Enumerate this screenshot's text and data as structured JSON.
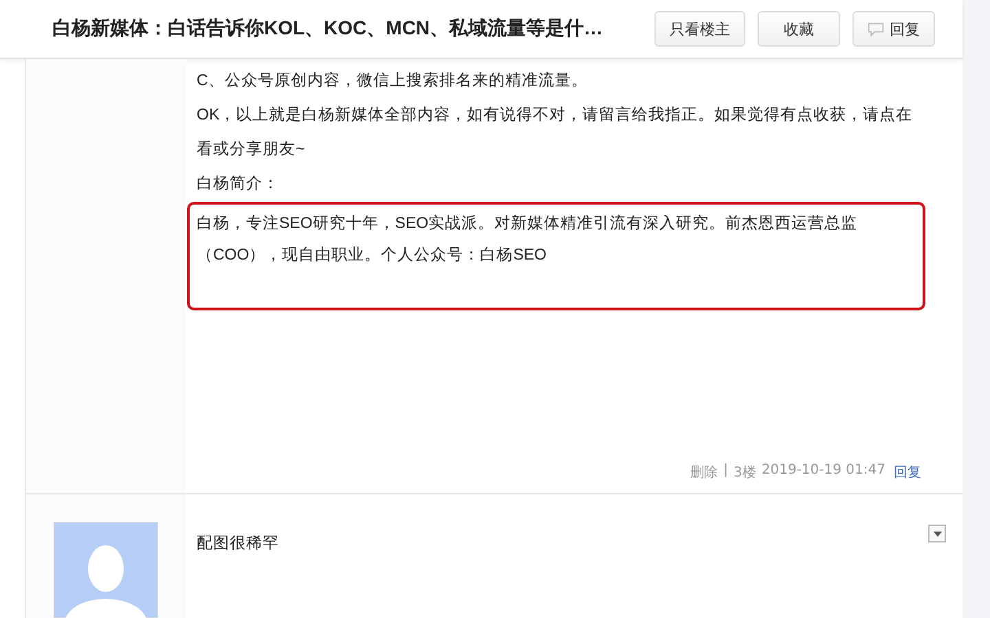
{
  "header": {
    "title": "白杨新媒体：白话告诉你KOL、KOC、MCN、私域流量等是什…",
    "buttons": [
      {
        "label": "只看楼主",
        "kind": "plain"
      },
      {
        "label": "收藏",
        "kind": "plain"
      },
      {
        "label": "回复",
        "kind": "reply"
      }
    ]
  },
  "posts": [
    {
      "paragraphs": [
        {
          "text": "C、公众号原创内容，微信上搜索排名来的精准流量。",
          "highlighted": false
        },
        {
          "text": "OK，以上就是白杨新媒体全部内容，如有说得不对，请留言给我指正。如果觉得有点收获，请点在看或分享朋友~",
          "highlighted": false
        },
        {
          "text": "白杨简介：",
          "highlighted": false
        },
        {
          "text": "白杨，专注SEO研究十年，SEO实战派。对新媒体精准引流有深入研究。前杰恩西运营总监（COO），现自由职业。个人公众号：白杨SEO",
          "highlighted": true
        }
      ],
      "meta": {
        "delete": "删除",
        "separator": "|",
        "floor": "3楼",
        "time": "2019-10-19 01:47",
        "reply": "回复"
      }
    },
    {
      "avatar": true,
      "paragraphs": [
        {
          "text": "配图很稀罕",
          "highlighted": false
        }
      ]
    }
  ]
}
